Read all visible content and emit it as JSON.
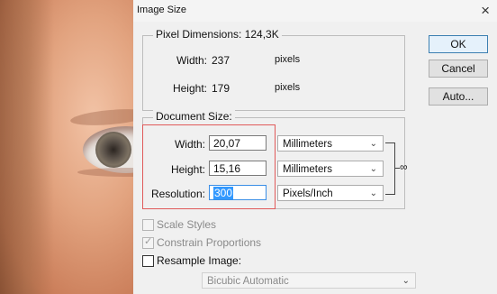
{
  "dialog": {
    "title": "Image Size",
    "close_glyph": "×"
  },
  "pixel_dimensions": {
    "legend": "Pixel Dimensions: 124,3K",
    "width_label": "Width:",
    "width_value": "237",
    "width_unit": "pixels",
    "height_label": "Height:",
    "height_value": "179",
    "height_unit": "pixels"
  },
  "document_size": {
    "legend": "Document Size:",
    "width_label": "Width:",
    "width_value": "20,07",
    "width_unit": "Millimeters",
    "height_label": "Height:",
    "height_value": "15,16",
    "height_unit": "Millimeters",
    "resolution_label": "Resolution:",
    "resolution_value": "300",
    "resolution_unit": "Pixels/Inch"
  },
  "buttons": {
    "ok": "OK",
    "cancel": "Cancel",
    "auto": "Auto..."
  },
  "options": {
    "scale_styles": "Scale Styles",
    "constrain_proportions": "Constrain Proportions",
    "resample_image": "Resample Image:",
    "resample_method": "Bicubic Automatic"
  },
  "icons": {
    "chain": "chain-link-icon"
  },
  "colors": {
    "highlight_box": "#e05a5a",
    "selection": "#3399ff"
  }
}
